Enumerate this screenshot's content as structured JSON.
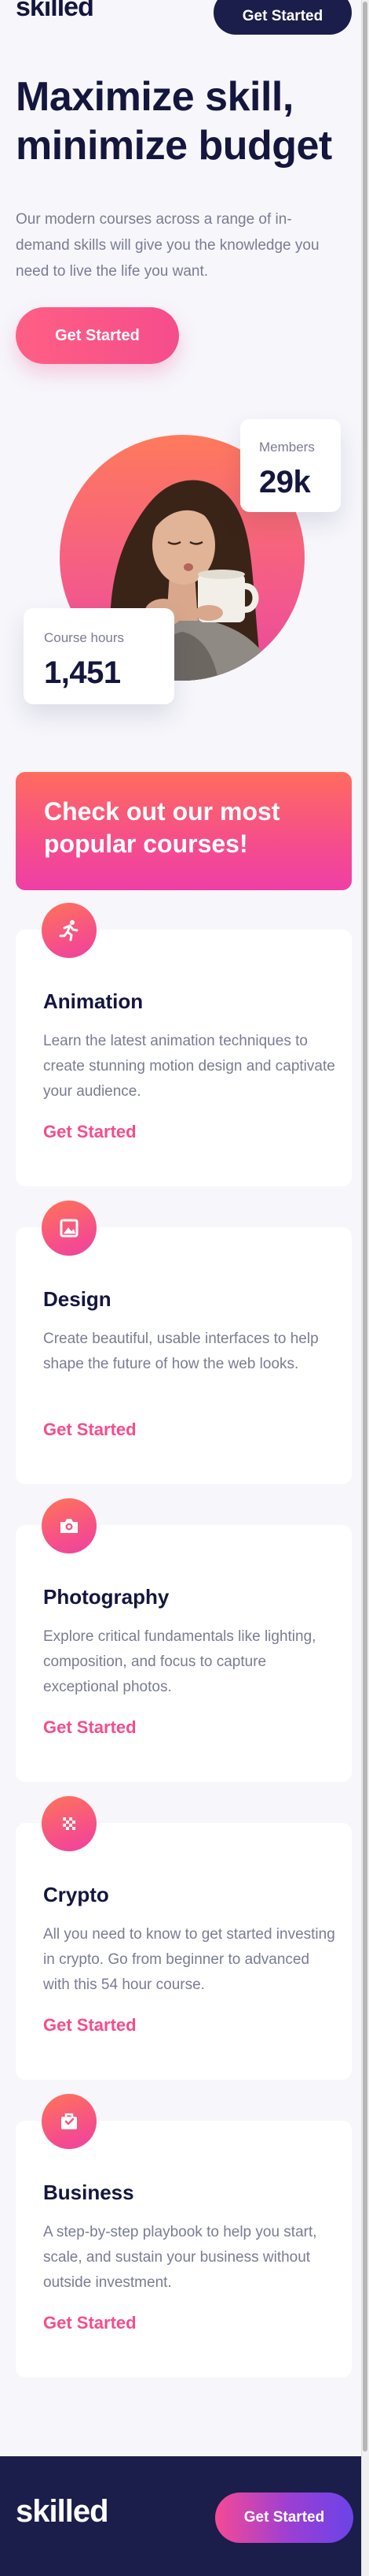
{
  "header": {
    "logo": "skilled",
    "cta_label": "Get Started"
  },
  "hero": {
    "title": "Maximize skill, minimize budget",
    "description": "Our modern courses across a range of in-demand skills will give you the knowledge you need to live the life you want.",
    "cta_label": "Get Started"
  },
  "stats": {
    "members_label": "Members",
    "members_value": "29k",
    "hours_label": "Course hours",
    "hours_value": "1,451"
  },
  "promo": {
    "text": "Check out our most popular courses!"
  },
  "courses": [
    {
      "title": "Animation",
      "icon": "running-figure-icon",
      "description": "Learn the latest animation techniques to create stunning motion design and captivate your audience.",
      "link": "Get Started"
    },
    {
      "title": "Design",
      "icon": "image-frame-icon",
      "description": "Create beautiful, usable interfaces to help shape the future of how the web looks.",
      "link": "Get Started"
    },
    {
      "title": "Photography",
      "icon": "camera-icon",
      "description": "Explore critical fundamentals like lighting, composition, and focus to capture exceptional photos.",
      "link": "Get Started"
    },
    {
      "title": "Crypto",
      "icon": "crypto-dots-icon",
      "description": "All you need to know to get started investing in crypto. Go from beginner to advanced with this 54 hour course.",
      "link": "Get Started"
    },
    {
      "title": "Business",
      "icon": "briefcase-icon",
      "description": "A step-by-step playbook to help you start, scale, and sustain your business without outside investment.",
      "link": "Get Started"
    }
  ],
  "footer": {
    "logo": "skilled",
    "cta_label": "Get Started"
  },
  "colors": {
    "navy": "#14163e",
    "accent_pink": "#f54d8c",
    "accent_orange": "#ff6f5b",
    "muted_text": "#7a7c93",
    "background": "#f6f6fb"
  }
}
